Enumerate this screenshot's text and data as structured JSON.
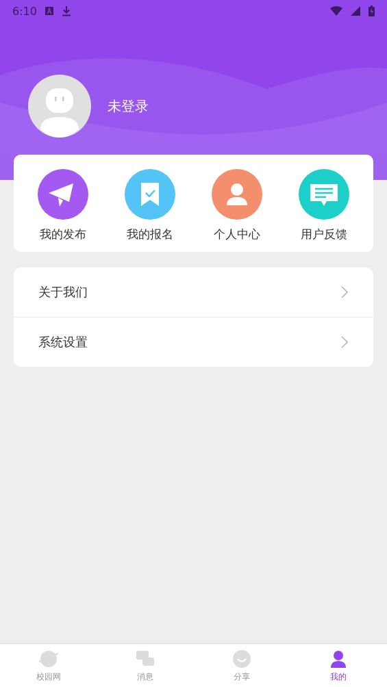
{
  "status_bar": {
    "time": "6:10"
  },
  "profile": {
    "name": "未登录"
  },
  "shortcuts": [
    {
      "label": "我的发布",
      "kind": "plane",
      "color": "#a45af0"
    },
    {
      "label": "我的报名",
      "kind": "bookmark",
      "color": "#54c4f7"
    },
    {
      "label": "个人中心",
      "kind": "person",
      "color": "#f38f6c"
    },
    {
      "label": "用户反馈",
      "kind": "chat",
      "color": "#1dcfc9"
    }
  ],
  "menu": [
    {
      "label": "关于我们"
    },
    {
      "label": "系统设置"
    }
  ],
  "tab_bar": [
    {
      "label": "校园网",
      "kind": "planet",
      "selected": false
    },
    {
      "label": "消息",
      "kind": "chat",
      "selected": false
    },
    {
      "label": "分享",
      "kind": "smile",
      "selected": false
    },
    {
      "label": "我的",
      "kind": "person",
      "selected": true
    }
  ]
}
